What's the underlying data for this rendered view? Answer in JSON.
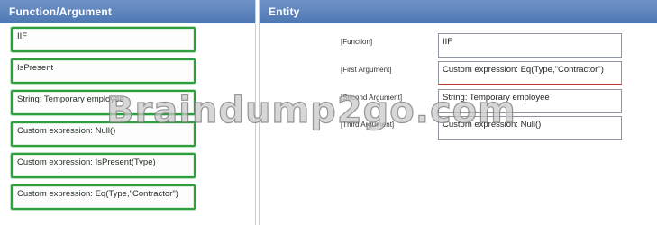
{
  "left_panel": {
    "title": "Function/Argument",
    "items": [
      {
        "label": "IIF"
      },
      {
        "label": "IsPresent"
      },
      {
        "label": "String: Temporary employee"
      },
      {
        "label": "Custom expression: Null()"
      },
      {
        "label": "Custom expression: IsPresent(Type)"
      },
      {
        "label": "Custom expression: Eq(Type,\"Contractor\")"
      }
    ]
  },
  "right_panel": {
    "title": "Entity",
    "rows": [
      {
        "label": "[Function]",
        "value": "IIF"
      },
      {
        "label": "[First Argument]",
        "value": "Custom expression: Eq(Type,\"Contractor\")"
      },
      {
        "label": "[Second Argument]",
        "value": "String: Temporary employee"
      },
      {
        "label": "[Third Argument]",
        "value": "Custom expression: Null()"
      }
    ]
  },
  "watermark": "Braindump2go.com",
  "colors": {
    "header": "#5b82bd",
    "item_border": "#2f9e3f",
    "active_field_underline": "#c0323a"
  }
}
